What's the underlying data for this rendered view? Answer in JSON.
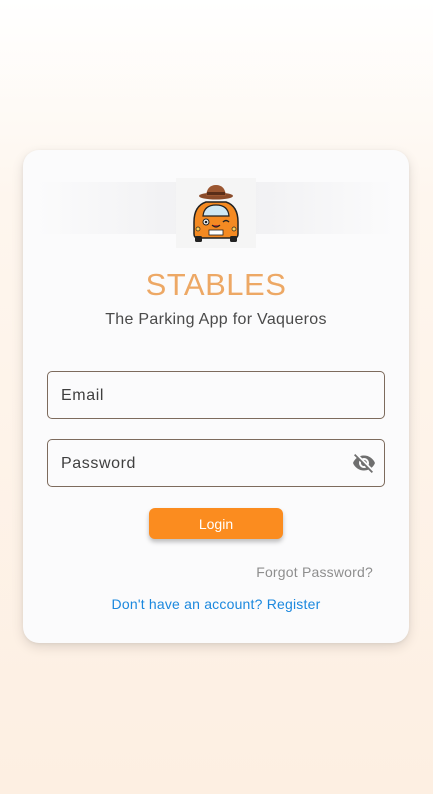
{
  "app": {
    "title": "STABLES",
    "subtitle": "The Parking App for Vaqueros",
    "logo_icon": "cowboy-car-logo"
  },
  "form": {
    "email_placeholder": "Email",
    "email_value": "",
    "password_placeholder": "Password",
    "password_value": "",
    "password_toggle_icon": "visibility-off-icon",
    "login_label": "Login",
    "forgot_label": "Forgot Password?",
    "register_label": "Don't have an account? Register"
  },
  "colors": {
    "brand_orange": "#fb8c1f",
    "title_color": "#eda865",
    "link_blue": "#1b88de"
  }
}
